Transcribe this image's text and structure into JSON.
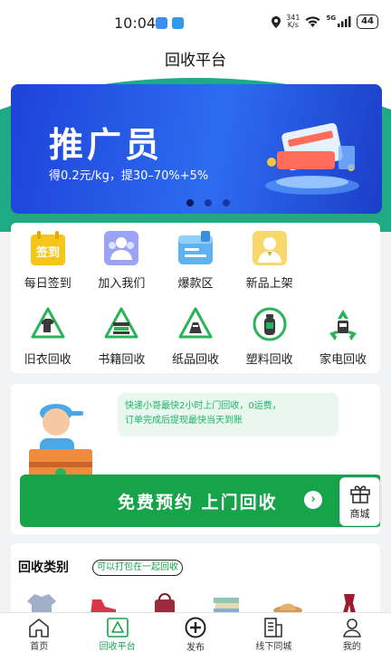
{
  "status_bar": {
    "time": "10:04",
    "net_speed_value": "341",
    "net_speed_unit": "K/s",
    "signal_label": "5G",
    "battery": "44"
  },
  "header": {
    "title": "回收平台"
  },
  "banner": {
    "title": "推广员",
    "subtitle": "得0.2元/kg，提30–70%+5%",
    "dots": 3,
    "active_dot": 0
  },
  "menu": {
    "row1": [
      {
        "label": "每日签到",
        "icon": "sign-in-icon",
        "icon_text": "签到"
      },
      {
        "label": "加入我们",
        "icon": "join-us-icon"
      },
      {
        "label": "爆款区",
        "icon": "hot-items-icon"
      },
      {
        "label": "新品上架",
        "icon": "new-products-icon"
      }
    ],
    "row2": [
      {
        "label": "旧衣回收",
        "icon": "clothes-recycle-icon"
      },
      {
        "label": "书籍回收",
        "icon": "books-recycle-icon"
      },
      {
        "label": "纸品回收",
        "icon": "paper-recycle-icon"
      },
      {
        "label": "塑料回收",
        "icon": "plastic-recycle-icon"
      },
      {
        "label": "家电回收",
        "icon": "appliance-recycle-icon"
      }
    ]
  },
  "appointment": {
    "bubble_line1": "快递小哥最快2小时上门回收，0运费，",
    "bubble_line2": "订单完成后提现最快当天到账",
    "button_label": "免费预约 上门回收",
    "mall_label": "商城"
  },
  "category": {
    "title": "回收类别",
    "tag": "可以打包在一起回收",
    "items": [
      "coat-icon",
      "sneaker-icon",
      "handbag-icon",
      "books-stack-icon",
      "hat-icon",
      "scarf-icon"
    ]
  },
  "tab_bar": {
    "tabs": [
      {
        "label": "首页",
        "icon": "home-icon"
      },
      {
        "label": "回收平台",
        "icon": "recycle-platform-icon",
        "active": true
      },
      {
        "label": "发布",
        "icon": "publish-icon"
      },
      {
        "label": "线下同城",
        "icon": "local-store-icon"
      },
      {
        "label": "我的",
        "icon": "profile-icon"
      }
    ]
  },
  "colors": {
    "brand_green": "#17a34a",
    "banner_blue": "#2d6cf1",
    "header_green": "#1faa86"
  }
}
